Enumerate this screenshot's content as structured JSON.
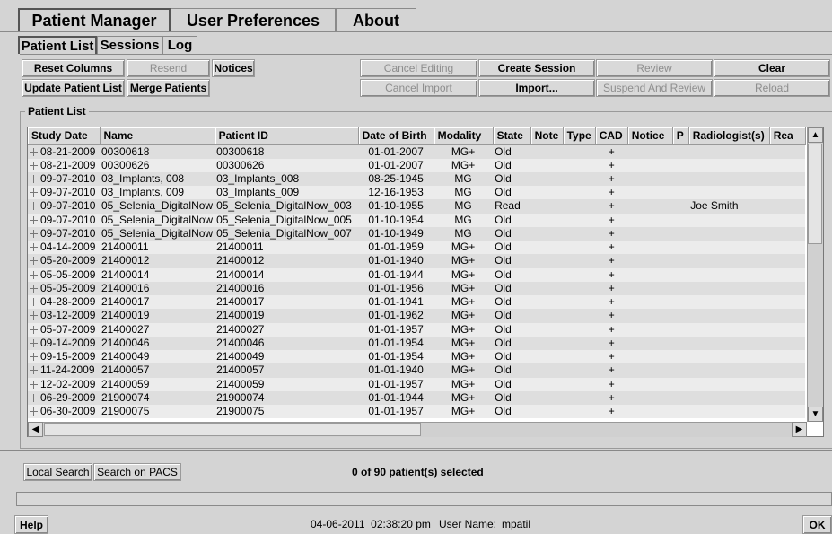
{
  "top_tabs": [
    "Patient Manager",
    "User Preferences",
    "About"
  ],
  "sub_tabs": [
    "Patient List",
    "Sessions",
    "Log"
  ],
  "buttons": {
    "reset_columns": "Reset Columns",
    "resend": "Resend",
    "notices": "Notices",
    "update_patient_list": "Update Patient List",
    "merge_patients": "Merge Patients",
    "cancel_editing": "Cancel Editing",
    "create_session": "Create Session",
    "review": "Review",
    "clear": "Clear",
    "cancel_import": "Cancel Import",
    "import": "Import...",
    "suspend_and_review": "Suspend And Review",
    "reload": "Reload",
    "local_search": "Local Search",
    "search_on_pacs": "Search on PACS",
    "help": "Help",
    "ok": "OK"
  },
  "patient_list": {
    "title": "Patient List",
    "columns": [
      "Study Date",
      "Name",
      "Patient ID",
      "Date of Birth",
      "Modality",
      "State",
      "Note",
      "Type",
      "CAD",
      "Notice",
      "P",
      "Radiologist(s)",
      "Rea"
    ],
    "rows": [
      [
        "08-21-2009",
        "00300618",
        "00300618",
        "01-01-2007",
        "MG+",
        "Old",
        "",
        "",
        "+",
        "",
        "",
        ""
      ],
      [
        "08-21-2009",
        "00300626",
        "00300626",
        "01-01-2007",
        "MG+",
        "Old",
        "",
        "",
        "+",
        "",
        "",
        ""
      ],
      [
        "09-07-2010",
        "03_Implants, 008",
        "03_Implants_008",
        "08-25-1945",
        "MG",
        "Old",
        "",
        "",
        "+",
        "",
        "",
        ""
      ],
      [
        "09-07-2010",
        "03_Implants, 009",
        "03_Implants_009",
        "12-16-1953",
        "MG",
        "Old",
        "",
        "",
        "+",
        "",
        "",
        ""
      ],
      [
        "09-07-2010",
        "05_Selenia_DigitalNow",
        "05_Selenia_DigitalNow_003",
        "01-10-1955",
        "MG",
        "Read",
        "",
        "",
        "+",
        "",
        "",
        "Joe Smith"
      ],
      [
        "09-07-2010",
        "05_Selenia_DigitalNow",
        "05_Selenia_DigitalNow_005",
        "01-10-1954",
        "MG",
        "Old",
        "",
        "",
        "+",
        "",
        "",
        ""
      ],
      [
        "09-07-2010",
        "05_Selenia_DigitalNow",
        "05_Selenia_DigitalNow_007",
        "01-10-1949",
        "MG",
        "Old",
        "",
        "",
        "+",
        "",
        "",
        ""
      ],
      [
        "04-14-2009",
        "21400011",
        "21400011",
        "01-01-1959",
        "MG+",
        "Old",
        "",
        "",
        "+",
        "",
        "",
        ""
      ],
      [
        "05-20-2009",
        "21400012",
        "21400012",
        "01-01-1940",
        "MG+",
        "Old",
        "",
        "",
        "+",
        "",
        "",
        ""
      ],
      [
        "05-05-2009",
        "21400014",
        "21400014",
        "01-01-1944",
        "MG+",
        "Old",
        "",
        "",
        "+",
        "",
        "",
        ""
      ],
      [
        "05-05-2009",
        "21400016",
        "21400016",
        "01-01-1956",
        "MG+",
        "Old",
        "",
        "",
        "+",
        "",
        "",
        ""
      ],
      [
        "04-28-2009",
        "21400017",
        "21400017",
        "01-01-1941",
        "MG+",
        "Old",
        "",
        "",
        "+",
        "",
        "",
        ""
      ],
      [
        "03-12-2009",
        "21400019",
        "21400019",
        "01-01-1962",
        "MG+",
        "Old",
        "",
        "",
        "+",
        "",
        "",
        ""
      ],
      [
        "05-07-2009",
        "21400027",
        "21400027",
        "01-01-1957",
        "MG+",
        "Old",
        "",
        "",
        "+",
        "",
        "",
        ""
      ],
      [
        "09-14-2009",
        "21400046",
        "21400046",
        "01-01-1954",
        "MG+",
        "Old",
        "",
        "",
        "+",
        "",
        "",
        ""
      ],
      [
        "09-15-2009",
        "21400049",
        "21400049",
        "01-01-1954",
        "MG+",
        "Old",
        "",
        "",
        "+",
        "",
        "",
        ""
      ],
      [
        "11-24-2009",
        "21400057",
        "21400057",
        "01-01-1940",
        "MG+",
        "Old",
        "",
        "",
        "+",
        "",
        "",
        ""
      ],
      [
        "12-02-2009",
        "21400059",
        "21400059",
        "01-01-1957",
        "MG+",
        "Old",
        "",
        "",
        "+",
        "",
        "",
        ""
      ],
      [
        "06-29-2009",
        "21900074",
        "21900074",
        "01-01-1944",
        "MG+",
        "Old",
        "",
        "",
        "+",
        "",
        "",
        ""
      ],
      [
        "06-30-2009",
        "21900075",
        "21900075",
        "01-01-1957",
        "MG+",
        "Old",
        "",
        "",
        "+",
        "",
        "",
        ""
      ]
    ]
  },
  "selection_status": "0 of 90 patient(s) selected",
  "footer": {
    "datetime": "04-06-2011  02:38:20 pm",
    "user_label": "User Name:",
    "user_name": "mpatil"
  },
  "icons": {
    "scroll_up": "triangle-up-icon",
    "scroll_down": "triangle-down-icon",
    "scroll_left": "triangle-left-icon",
    "scroll_right": "triangle-right-icon",
    "expand": "plus-expand-icon"
  }
}
